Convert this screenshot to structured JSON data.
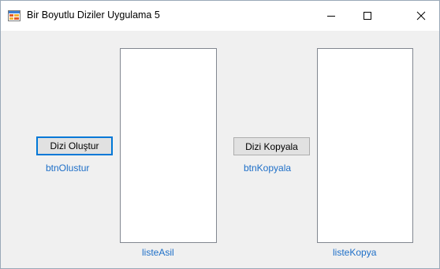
{
  "window": {
    "title": "Bir Boyutlu Diziler Uygulama 5",
    "icon": "winforms-app-icon",
    "controls": {
      "minimize_icon": "minimize-icon",
      "maximize_icon": "maximize-icon",
      "close_icon": "close-icon"
    }
  },
  "form": {
    "btn_olustur": {
      "label": "Dizi Oluştur",
      "caption": "btnOlustur"
    },
    "liste_asil": {
      "caption": "listeAsil",
      "items": []
    },
    "btn_kopyala": {
      "label": "Dizi Kopyala",
      "caption": "btnKopyala"
    },
    "liste_kopya": {
      "caption": "listeKopya",
      "items": []
    }
  },
  "colors": {
    "titlebar_bg": "#ffffff",
    "client_bg": "#f0f0f0",
    "caption_text": "#1e6fc8",
    "focus_border": "#0078d7"
  }
}
